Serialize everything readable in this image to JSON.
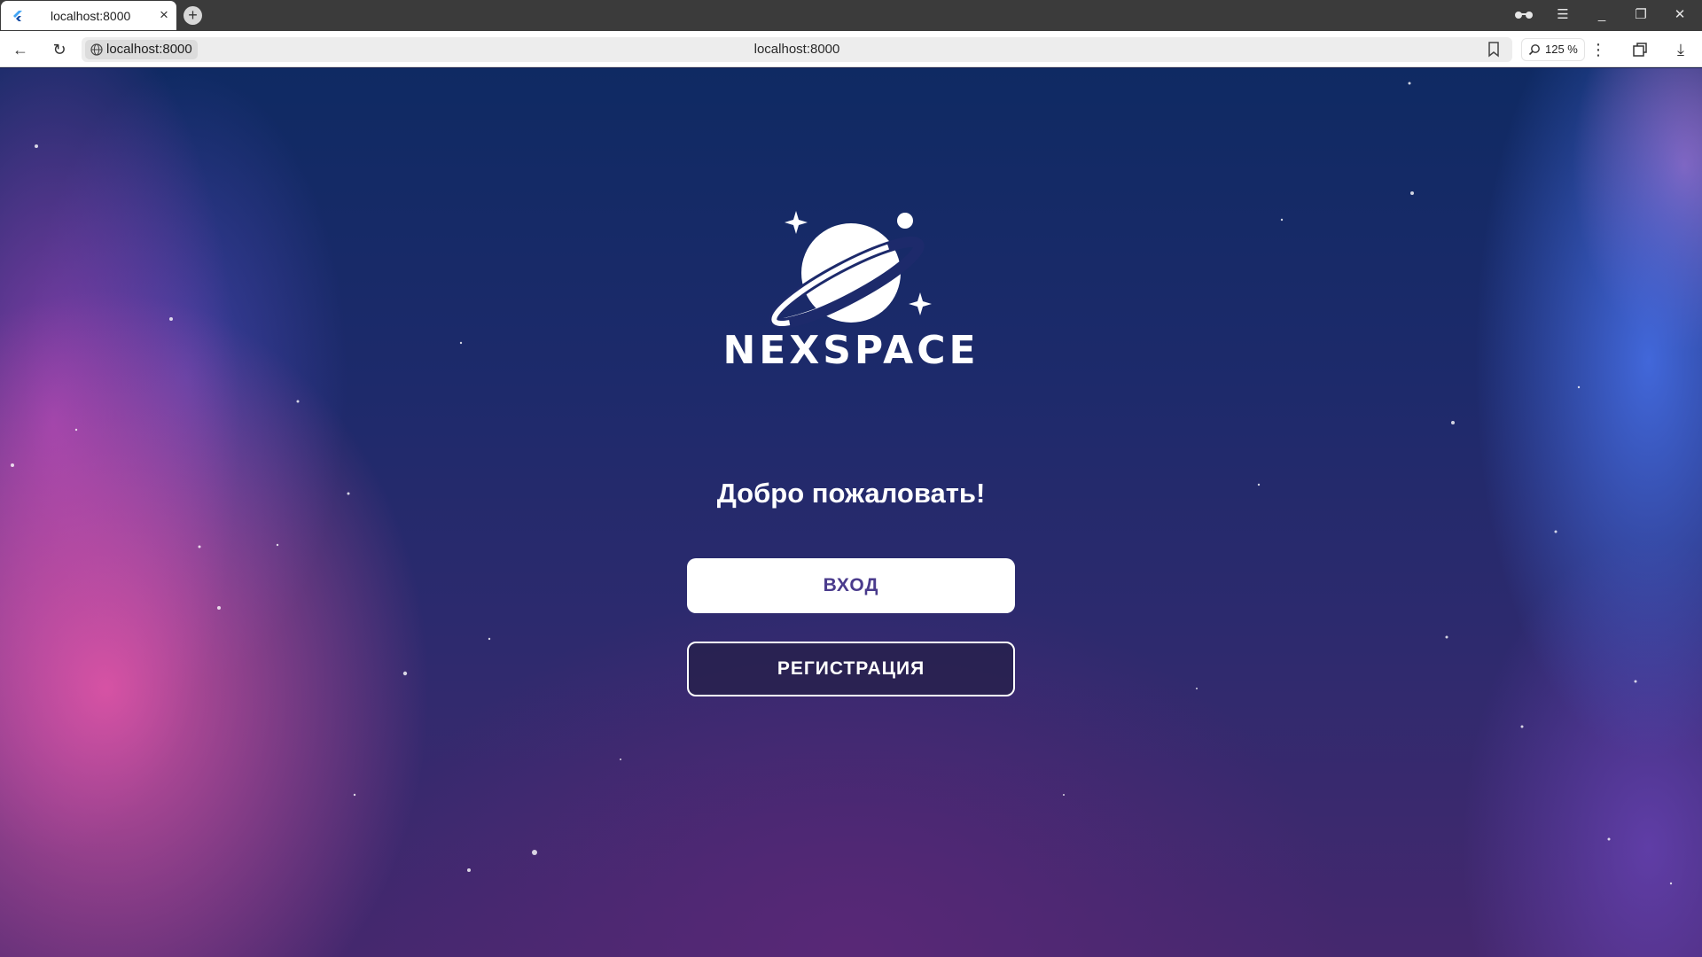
{
  "browser": {
    "tab_title": "localhost:8000",
    "tab_close_glyph": "×",
    "new_tab_glyph": "+",
    "window_controls": {
      "reading_mode_icon": "glasses-icon",
      "menu_glyph": "☰",
      "minimize_glyph": "_",
      "restore_glyph": "❐",
      "close_glyph": "✕"
    },
    "back_glyph": "←",
    "reload_glyph": "↻",
    "address_text": "localhost:8000",
    "address_center": "localhost:8000",
    "zoom_level": "125 %",
    "more_glyph": "⋮",
    "download_glyph": "⤓"
  },
  "page": {
    "brand_name": "NEXSPACE",
    "welcome_text": "Добро пожаловать!",
    "login_label": "ВХОД",
    "register_label": "РЕГИСТРАЦИЯ",
    "colors": {
      "login_text": "#4a3b8c",
      "background_top": "#0f2a63",
      "background_bottom": "#45286e",
      "nebula_pink": "#ee58aa",
      "nebula_blue": "#466ee6"
    }
  }
}
